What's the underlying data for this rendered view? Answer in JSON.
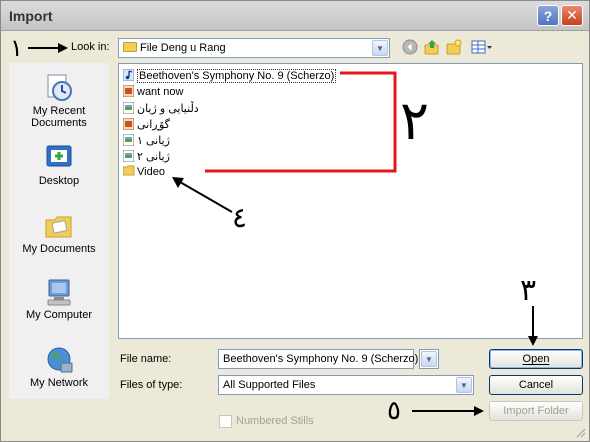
{
  "window": {
    "title": "Import"
  },
  "titlebar": {
    "help_glyph": "?",
    "close_glyph": "✕"
  },
  "lookin": {
    "label": "Look in:",
    "value": "File Deng u Rang",
    "dropdown_glyph": "▼"
  },
  "toolbar": [
    {
      "name": "back-icon",
      "glyph": "◀"
    },
    {
      "name": "up-folder-icon",
      "glyph": "↑"
    },
    {
      "name": "new-folder-icon",
      "glyph": "✱"
    },
    {
      "name": "view-menu-icon",
      "glyph": "▦▾"
    }
  ],
  "places": [
    {
      "name": "my-recent-documents",
      "label": "My Recent Documents",
      "icon": "clock-icon"
    },
    {
      "name": "desktop",
      "label": "Desktop",
      "icon": "desktop-icon"
    },
    {
      "name": "my-documents",
      "label": "My Documents",
      "icon": "folder-icon"
    },
    {
      "name": "my-computer",
      "label": "My Computer",
      "icon": "computer-icon"
    },
    {
      "name": "my-network",
      "label": "My Network",
      "icon": "globe-icon"
    }
  ],
  "files": [
    {
      "name": "Beethoven's Symphony No. 9 (Scherzo)",
      "type": "audio",
      "selected": true
    },
    {
      "name": "want now",
      "type": "video",
      "selected": false
    },
    {
      "name": "دڵنیایی و ژیان",
      "type": "image",
      "selected": false
    },
    {
      "name": "گۆڕانی",
      "type": "video",
      "selected": false
    },
    {
      "name": "ژیانی ١",
      "type": "image",
      "selected": false
    },
    {
      "name": "ژیانی ٢",
      "type": "image",
      "selected": false
    },
    {
      "name": "Video",
      "type": "folder",
      "selected": false
    }
  ],
  "filename": {
    "label": "File name:",
    "value": "Beethoven's Symphony No. 9 (Scherzo)",
    "dropdown_glyph": "▼"
  },
  "filetype": {
    "label": "Files of type:",
    "value": "All Supported Files",
    "dropdown_glyph": "▼"
  },
  "buttons": {
    "open": "Open",
    "cancel": "Cancel",
    "import_folder": "Import Folder"
  },
  "numbered_stills": {
    "label": "Numbered Stills",
    "checked": false,
    "enabled": false
  },
  "annotations": {
    "n1": "١",
    "n2": "٢",
    "n3": "٣",
    "n4": "٤",
    "n5": "٥",
    "bracket_color": "#e8141b"
  },
  "colors": {
    "dialog_bg": "#ece9d8",
    "list_border": "#7f9db9",
    "button_border": "#003c74"
  }
}
